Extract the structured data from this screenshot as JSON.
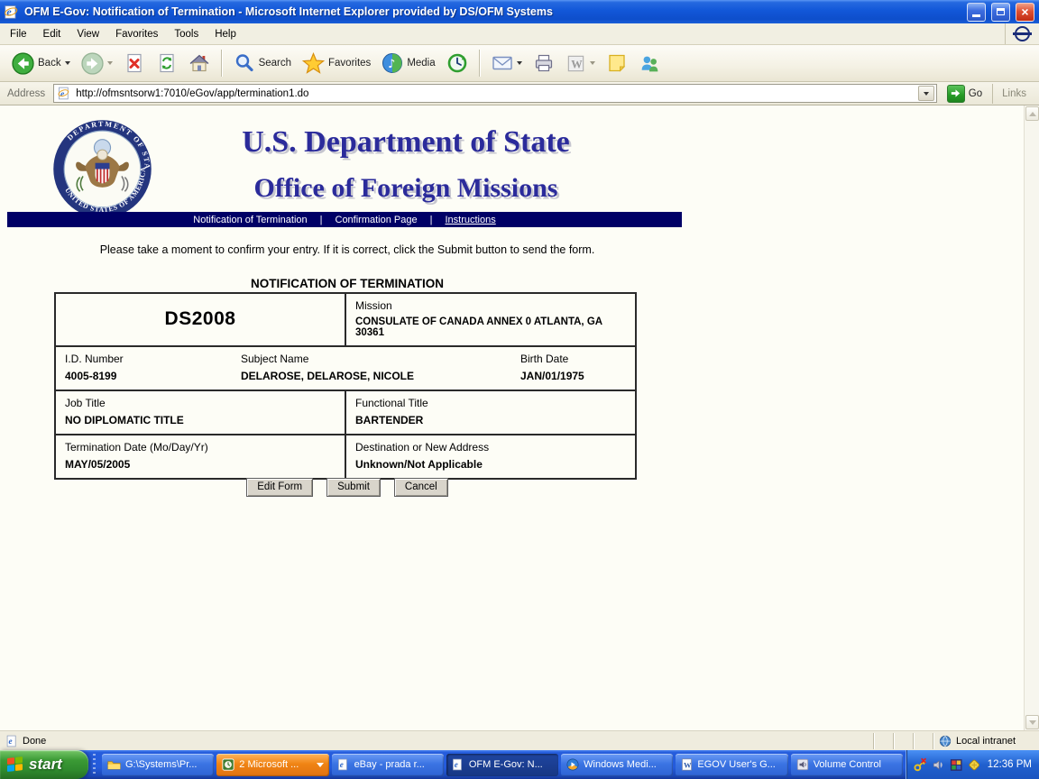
{
  "window": {
    "title": "OFM E-Gov: Notification of Termination - Microsoft Internet Explorer provided by DS/OFM Systems",
    "menu": [
      "File",
      "Edit",
      "View",
      "Favorites",
      "Tools",
      "Help"
    ]
  },
  "toolbar": {
    "back": "Back",
    "search": "Search",
    "favorites": "Favorites",
    "media": "Media"
  },
  "address_bar": {
    "label": "Address",
    "url": "http://ofmsntsorw1:7010/eGov/app/termination1.do",
    "go": "Go",
    "links": "Links"
  },
  "page": {
    "header": {
      "line1": "U.S. Department of State",
      "line2": "Office of Foreign Missions",
      "seal_top": "DEPARTMENT OF STATE",
      "seal_bottom": "UNITED STATES OF AMERICA"
    },
    "nav": {
      "items": [
        "Notification of Termination",
        "Confirmation Page",
        "Instructions"
      ],
      "separator": "|"
    },
    "message": "Please take a moment to confirm your entry. If it is correct, click the Submit button to send the form.",
    "form_title": "NOTIFICATION OF TERMINATION",
    "form": {
      "code": "DS2008",
      "mission": {
        "label": "Mission",
        "value": "CONSULATE OF CANADA ANNEX 0 ATLANTA, GA 30361"
      },
      "id_number": {
        "label": "I.D. Number",
        "value": "4005-8199"
      },
      "subject_name": {
        "label": "Subject Name",
        "value": "DELAROSE, DELAROSE, NICOLE"
      },
      "birth_date": {
        "label": "Birth Date",
        "value": "JAN/01/1975"
      },
      "job_title": {
        "label": "Job Title",
        "value": "NO DIPLOMATIC TITLE"
      },
      "functional_title": {
        "label": "Functional Title",
        "value": "BARTENDER"
      },
      "termination_date": {
        "label": "Termination Date (Mo/Day/Yr)",
        "value": "MAY/05/2005"
      },
      "destination": {
        "label": "Destination or New Address",
        "value": "Unknown/Not Applicable"
      }
    },
    "buttons": {
      "edit": "Edit Form",
      "submit": "Submit",
      "cancel": "Cancel"
    }
  },
  "status_bar": {
    "status": "Done",
    "zone": "Local intranet"
  },
  "taskbar": {
    "start": "start",
    "items": [
      {
        "label": "G:\\Systems\\Pr..."
      },
      {
        "label": "2 Microsoft ..."
      },
      {
        "label": "eBay - prada r..."
      },
      {
        "label": "OFM E-Gov: N..."
      },
      {
        "label": "Windows Medi..."
      },
      {
        "label": "EGOV User's G..."
      },
      {
        "label": "Volume Control"
      }
    ],
    "clock": "12:36 PM"
  },
  "icons": {
    "ie_glyph": "e",
    "word_glyph": "W",
    "media_note": "♪"
  },
  "colors": {
    "nav_bar": "#000066",
    "header_text": "#2B2B9B",
    "xp_taskbar_blue": "#245BDB",
    "taskbar_orange": "#F08414",
    "start_green": "#2F8A2D"
  }
}
